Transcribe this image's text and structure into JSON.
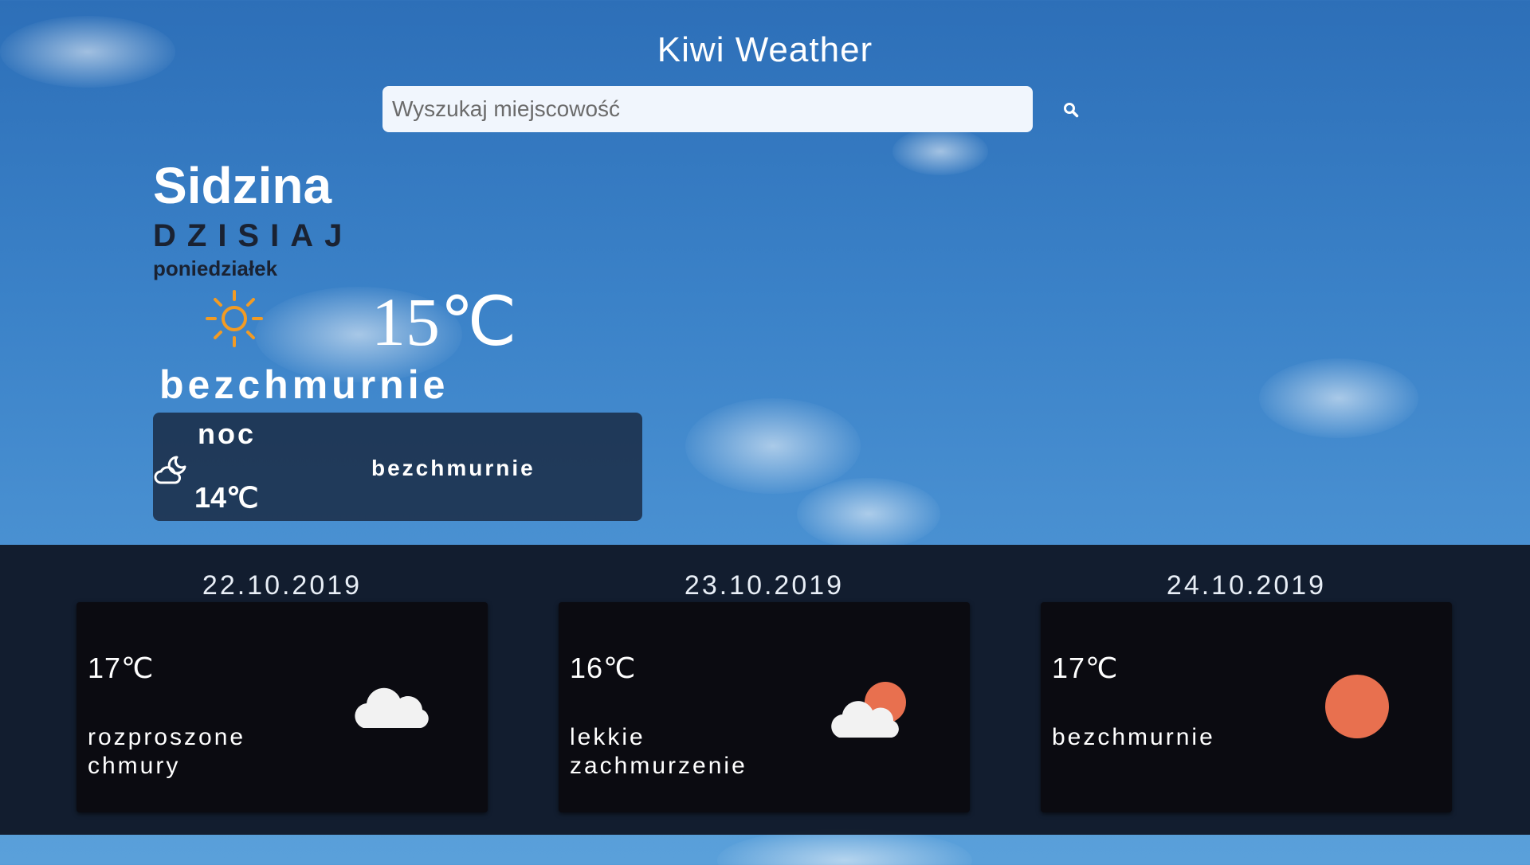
{
  "app": {
    "title": "Kiwi Weather"
  },
  "search": {
    "placeholder": "Wyszukaj miejscowość",
    "value": "",
    "icon": "search-icon"
  },
  "current": {
    "city": "Sidzina",
    "day_label": "DZISIAJ",
    "weekday": "poniedziałek",
    "icon": "sun-icon",
    "temperature": "15℃",
    "description": "bezchmurnie",
    "night": {
      "label": "noc",
      "icon": "moon-cloud-icon",
      "temperature": "14℃",
      "description": "bezchmurnie"
    }
  },
  "forecast": [
    {
      "date": "22.10.2019",
      "temperature": "17℃",
      "description": "rozproszone chmury",
      "icon": "cloud-icon"
    },
    {
      "date": "23.10.2019",
      "temperature": "16℃",
      "description": "lekkie zachmurzenie",
      "icon": "sun-behind-cloud-icon"
    },
    {
      "date": "24.10.2019",
      "temperature": "17℃",
      "description": "bezchmurnie",
      "icon": "sun-icon"
    }
  ],
  "colors": {
    "sun": "#f29b24",
    "forecast_sun": "#e8704f",
    "cloud": "#f2f2f2",
    "card_background": "#0b0b11",
    "band_background": "#101828"
  }
}
